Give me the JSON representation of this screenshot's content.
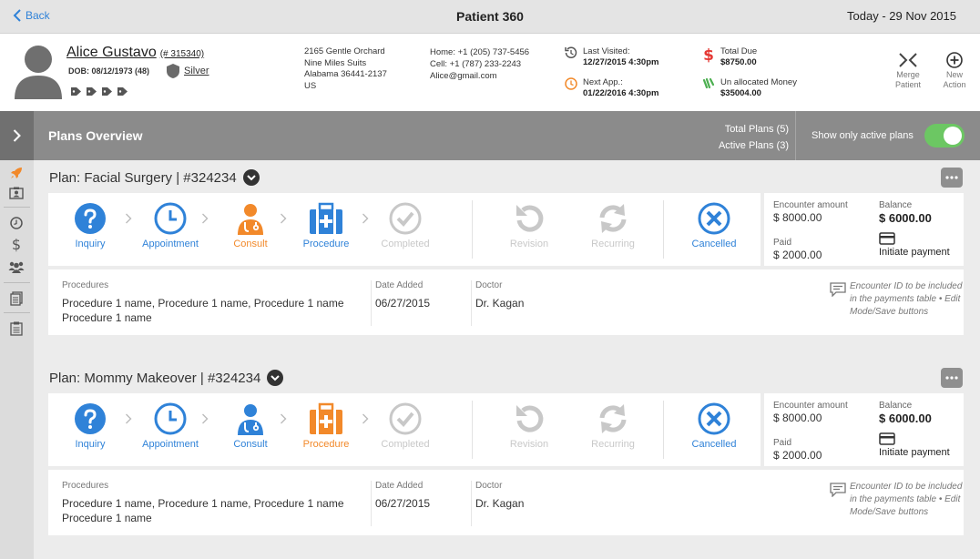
{
  "nav": {
    "back_label": "Back",
    "page_title": "Patient 360",
    "today": "Today - 29 Nov 2015"
  },
  "patient": {
    "name": "Alice Gustavo",
    "id": "(# 315340)",
    "dob": "DOB: 08/12/1973 (48)",
    "tier": "Silver",
    "address": [
      "2165 Gentle Orchard",
      "Nine Miles Suits",
      "Alabama 36441-2137",
      "US"
    ],
    "contact": [
      "Home: +1 (205) 737-5456",
      "Cell: +1 (787) 233-2243",
      "Alice@gmail.com"
    ],
    "last_visited_label": "Last Visited:",
    "last_visited": "12/27/2015 4:30pm",
    "next_app_label": "Next App.:",
    "next_app": "01/22/2016 4:30pm",
    "total_due_label": "Total Due",
    "total_due": "$8750.00",
    "unallocated_label": "Un allocated Money",
    "unallocated": "$35004.00"
  },
  "header_actions": {
    "merge": [
      "Merge",
      "Patient"
    ],
    "new_action": [
      "New",
      "Action"
    ]
  },
  "overview": {
    "title": "Plans Overview",
    "total_plans": "Total Plans (5)",
    "active_plans": "Active Plans (3)",
    "toggle_label": "Show only active plans",
    "toggle_on": true
  },
  "stage_labels": [
    "Inquiry",
    "Appointment",
    "Consult",
    "Procedure",
    "Completed",
    "Revision",
    "Recurring",
    "Cancelled"
  ],
  "colors": {
    "blue": "#2f82d8",
    "orange": "#f2892a",
    "gray": "#c8c8c8",
    "green": "#6cc763",
    "red": "#e53935"
  },
  "plans": [
    {
      "title": "Plan: Facial Surgery | #324234",
      "active_stage": "Consult",
      "encounter_label": "Encounter amount",
      "encounter": "$ 8000.00",
      "paid_label": "Paid",
      "paid": "$ 2000.00",
      "balance_label": "Balance",
      "balance": "$ 6000.00",
      "initiate": "Initiate payment",
      "procedures_label": "Procedures",
      "procedures": "Procedure 1 name, Procedure 1 name, Procedure 1 name Procedure 1 name",
      "date_label": "Date Added",
      "date": "06/27/2015",
      "doctor_label": "Doctor",
      "doctor": "Dr. Kagan",
      "note": "Encounter ID to be included in the payments table • Edit Mode/Save buttons"
    },
    {
      "title": "Plan: Mommy Makeover | #324234",
      "active_stage": "Procedure",
      "encounter_label": "Encounter amount",
      "encounter": "$ 8000.00",
      "paid_label": "Paid",
      "paid": "$ 2000.00",
      "balance_label": "Balance",
      "balance": "$ 6000.00",
      "initiate": "Initiate payment",
      "procedures_label": "Procedures",
      "procedures": "Procedure 1 name, Procedure 1 name, Procedure 1 name Procedure 1 name",
      "date_label": "Date Added",
      "date": "06/27/2015",
      "doctor_label": "Doctor",
      "doctor": "Dr. Kagan",
      "note": "Encounter ID to be included in the payments table • Edit Mode/Save buttons"
    }
  ]
}
